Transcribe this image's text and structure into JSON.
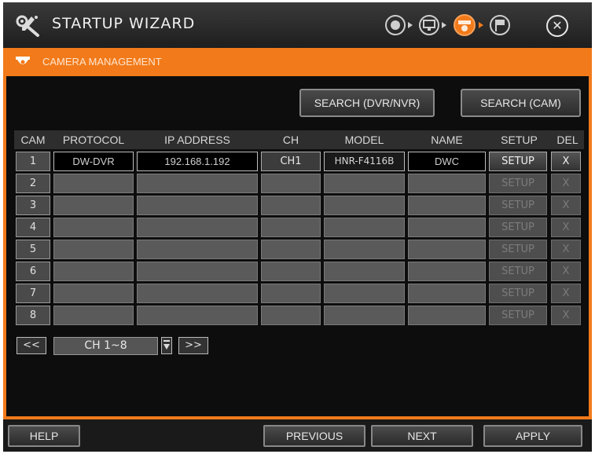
{
  "header": {
    "title": "STARTUP WIZARD",
    "steps": [
      "network-icon",
      "monitor-icon",
      "camera-icon",
      "finish-flag-icon"
    ],
    "active_step": 2,
    "close_icon": "close-icon"
  },
  "section": {
    "title": "CAMERA MANAGEMENT",
    "icon": "camera-icon"
  },
  "toolbar": {
    "search_dvr_label": "SEARCH (DVR/NVR)",
    "search_cam_label": "SEARCH (CAM)"
  },
  "table": {
    "columns": [
      "CAM",
      "PROTOCOL",
      "IP ADDRESS",
      "CH",
      "MODEL",
      "NAME",
      "SETUP",
      "DEL"
    ],
    "rows": [
      {
        "cam": "1",
        "protocol": "DW-DVR",
        "ip": "192.168.1.192",
        "ch": "CH1",
        "model": "HNR-F4116B",
        "name": "DWC",
        "setup": "SETUP",
        "del": "X",
        "enabled": true
      },
      {
        "cam": "2",
        "protocol": "",
        "ip": "",
        "ch": "",
        "model": "",
        "name": "",
        "setup": "SETUP",
        "del": "X",
        "enabled": false
      },
      {
        "cam": "3",
        "protocol": "",
        "ip": "",
        "ch": "",
        "model": "",
        "name": "",
        "setup": "SETUP",
        "del": "X",
        "enabled": false
      },
      {
        "cam": "4",
        "protocol": "",
        "ip": "",
        "ch": "",
        "model": "",
        "name": "",
        "setup": "SETUP",
        "del": "X",
        "enabled": false
      },
      {
        "cam": "5",
        "protocol": "",
        "ip": "",
        "ch": "",
        "model": "",
        "name": "",
        "setup": "SETUP",
        "del": "X",
        "enabled": false
      },
      {
        "cam": "6",
        "protocol": "",
        "ip": "",
        "ch": "",
        "model": "",
        "name": "",
        "setup": "SETUP",
        "del": "X",
        "enabled": false
      },
      {
        "cam": "7",
        "protocol": "",
        "ip": "",
        "ch": "",
        "model": "",
        "name": "",
        "setup": "SETUP",
        "del": "X",
        "enabled": false
      },
      {
        "cam": "8",
        "protocol": "",
        "ip": "",
        "ch": "",
        "model": "",
        "name": "",
        "setup": "SETUP",
        "del": "X",
        "enabled": false
      }
    ]
  },
  "pager": {
    "prev_label": "<<",
    "range": "CH 1~8",
    "next_label": ">>"
  },
  "footer": {
    "help_label": "HELP",
    "previous_label": "PREVIOUS",
    "next_label": "NEXT",
    "apply_label": "APPLY"
  },
  "colors": {
    "accent": "#f27a1a",
    "background": "#0c0c0c"
  }
}
